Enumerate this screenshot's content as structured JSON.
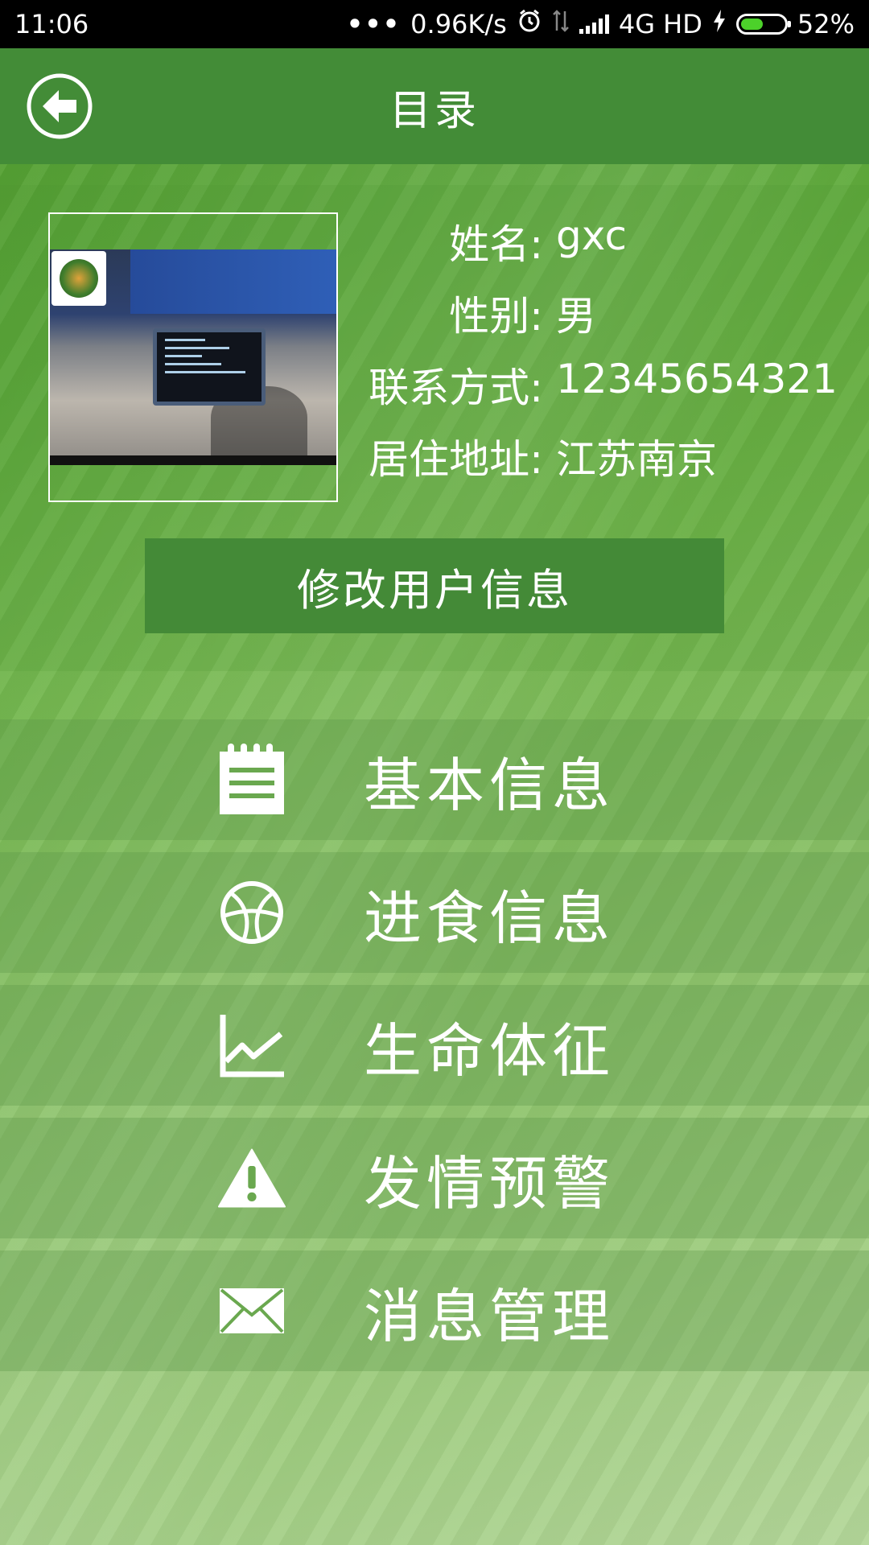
{
  "status_bar": {
    "time": "11:06",
    "dots": "•••",
    "network_speed": "0.96K/s",
    "network_type": "4G HD",
    "battery_percent": "52%",
    "battery_level": 0.52,
    "icons": [
      "alarm-icon",
      "data-arrows-icon",
      "signal-icon",
      "charging-icon",
      "battery-icon"
    ]
  },
  "header": {
    "title": "目录",
    "back_icon": "back-arrow-icon"
  },
  "profile": {
    "name_label": "姓名:",
    "name_value": "gxc",
    "gender_label": "性别:",
    "gender_value": "男",
    "contact_label": "联系方式:",
    "contact_value": "12345654321",
    "address_label": "居住地址:",
    "address_value": "江苏南京",
    "edit_button_label": "修改用户信息"
  },
  "menu": {
    "items": [
      {
        "label": "基本信息",
        "icon": "notepad-icon"
      },
      {
        "label": "进食信息",
        "icon": "basketball-icon"
      },
      {
        "label": "生命体征",
        "icon": "line-chart-icon"
      },
      {
        "label": "发情预警",
        "icon": "warning-icon"
      },
      {
        "label": "消息管理",
        "icon": "envelope-icon"
      }
    ]
  },
  "colors": {
    "header_bg": "#438c37",
    "button_bg": "#448a37",
    "status_bar_bg": "#000000",
    "battery_fill": "#4cd12a"
  }
}
